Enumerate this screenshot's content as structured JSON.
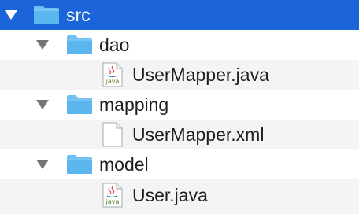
{
  "tree": {
    "items": [
      {
        "label": "src",
        "type": "folder",
        "expanded": true,
        "selected": true
      },
      {
        "label": "dao",
        "type": "folder",
        "expanded": true,
        "selected": false
      },
      {
        "label": "UserMapper.java",
        "type": "java-file",
        "icon_text": "java",
        "selected": false
      },
      {
        "label": "mapping",
        "type": "folder",
        "expanded": true,
        "selected": false
      },
      {
        "label": "UserMapper.xml",
        "type": "file",
        "selected": false
      },
      {
        "label": "model",
        "type": "folder",
        "expanded": true,
        "selected": false
      },
      {
        "label": "User.java",
        "type": "java-file",
        "icon_text": "java",
        "selected": false
      }
    ]
  },
  "colors": {
    "selection": "#1c64d9",
    "folder": "#5bb6ef",
    "alt_row": "#f4f4f4",
    "disclosure": "#747474"
  }
}
